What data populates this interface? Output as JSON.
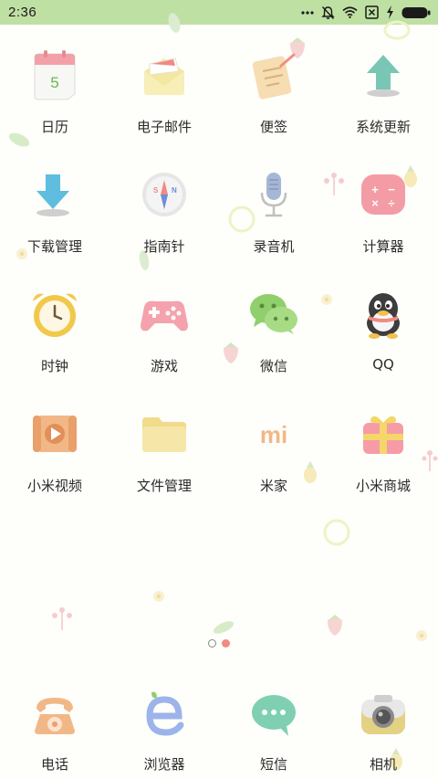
{
  "status_bar": {
    "time": "2:36",
    "icons": [
      "more-dots-icon",
      "notification-muted-icon",
      "wifi-icon",
      "no-sim-icon",
      "charging-icon",
      "battery-icon"
    ]
  },
  "apps": [
    {
      "label": "日历",
      "icon": "calendar-icon",
      "calendar_day": "5"
    },
    {
      "label": "电子邮件",
      "icon": "email-icon"
    },
    {
      "label": "便签",
      "icon": "notes-icon"
    },
    {
      "label": "系统更新",
      "icon": "system-update-icon"
    },
    {
      "label": "下载管理",
      "icon": "download-icon"
    },
    {
      "label": "指南针",
      "icon": "compass-icon"
    },
    {
      "label": "录音机",
      "icon": "microphone-icon"
    },
    {
      "label": "计算器",
      "icon": "calculator-icon"
    },
    {
      "label": "时钟",
      "icon": "clock-icon"
    },
    {
      "label": "游戏",
      "icon": "gamepad-icon"
    },
    {
      "label": "微信",
      "icon": "wechat-icon"
    },
    {
      "label": "QQ",
      "icon": "qq-penguin-icon"
    },
    {
      "label": "小米视频",
      "icon": "video-play-icon"
    },
    {
      "label": "文件管理",
      "icon": "folder-icon"
    },
    {
      "label": "米家",
      "icon": "mijia-icon",
      "logo_text": "mi"
    },
    {
      "label": "小米商城",
      "icon": "gift-box-icon"
    }
  ],
  "page_indicator": {
    "total": 2,
    "current": 2
  },
  "dock": [
    {
      "label": "电话",
      "icon": "telephone-icon"
    },
    {
      "label": "浏览器",
      "icon": "browser-icon"
    },
    {
      "label": "短信",
      "icon": "message-bubble-icon"
    },
    {
      "label": "相机",
      "icon": "camera-icon"
    }
  ],
  "colors": {
    "status_bar": "#bfe0a3",
    "background": "#fefefb",
    "active_dot": "#f08a82"
  }
}
